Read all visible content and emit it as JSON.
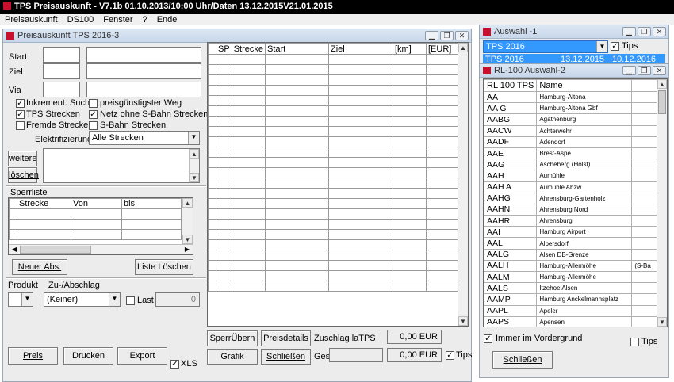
{
  "app": {
    "title": "TPS Preisauskunft  - V7.1b 01.10.2013/10:00 Uhr/Daten 13.12.2015V21.01.2015",
    "menu": [
      "Preisauskunft",
      "DS100",
      "Fenster",
      "?",
      "Ende"
    ]
  },
  "preis_window": {
    "title": "Preisauskunft TPS 2016-3",
    "labels": {
      "start": "Start",
      "ziel": "Ziel",
      "via": "Via"
    },
    "checks": {
      "inkrement": {
        "label": "Inkrement. Suche",
        "checked": true
      },
      "preisguenstig": {
        "label": "preisgünstigster Weg",
        "checked": false
      },
      "tps_strecken": {
        "label": "TPS Strecken",
        "checked": true
      },
      "netz_ohne_sbahn": {
        "label": "Netz ohne S-Bahn Strecken",
        "checked": true
      },
      "fremde": {
        "label": "Fremde Strecken",
        "checked": false
      },
      "sbahn": {
        "label": "S-Bahn Strecken",
        "checked": false
      }
    },
    "elektrifizierung": {
      "label": "Elektrifizierung",
      "value": "Alle Strecken"
    },
    "weitere_label": "weitere",
    "loeschen_label": "löschen",
    "sperrliste": {
      "title": "Sperrliste",
      "columns": [
        "Strecke",
        "Von",
        "bis"
      ]
    },
    "neuer_abs_label": "Neuer Abs.",
    "liste_loeschen_label": "Liste Löschen",
    "produkt_label": "Produkt",
    "zuabschlag_label": "Zu-/Abschlag",
    "zuabschlag_value": "(Keiner)",
    "last_label": "Last",
    "last_value": "0",
    "results_columns": [
      "SP",
      "Strecke",
      "Start",
      "Ziel",
      "[km]",
      "[EUR]"
    ],
    "buttons": {
      "sperr_uebern": "SperrÜbern",
      "preisdetails": "Preisdetails",
      "grafik": "Grafik",
      "schliessen": "Schließen",
      "preis": "Preis",
      "drucken": "Drucken",
      "export": "Export"
    },
    "zuschlag_label": "Zuschlag laTPS",
    "zuschlag_value": "0,00 EUR",
    "ges_label": "Ges.",
    "ges_value": "0,00 EUR",
    "tips_label": "Tips",
    "xls_label": "XLS"
  },
  "auswahl_window": {
    "title": "Auswahl -1",
    "combo_value": "TPS 2016",
    "tips_label": "Tips",
    "selected_row": [
      "TPS 2016",
      "13.12.2015",
      "10.12.2016"
    ]
  },
  "rl_window": {
    "title": "RL-100 Auswahl-2",
    "columns": [
      "RL 100 TPS",
      "Name"
    ],
    "rows": [
      [
        "AA",
        "Hamburg-Altona"
      ],
      [
        "AA  G",
        "Hamburg-Altona Gbf"
      ],
      [
        "AABG",
        "Agathenburg"
      ],
      [
        "AACW",
        "Achterwehr"
      ],
      [
        "AADF",
        "Adendorf"
      ],
      [
        "AAE",
        "Brest-Aspe"
      ],
      [
        "AAG",
        "Ascheberg (Holst)"
      ],
      [
        "AAH",
        "Aumühle"
      ],
      [
        "AAH A",
        "Aumühle Abzw"
      ],
      [
        "AAHG",
        "Ahrensburg-Gartenholz"
      ],
      [
        "AAHN",
        "Ahrensburg Nord"
      ],
      [
        "AAHR",
        "Ahrensburg"
      ],
      [
        "AAI",
        "Hamburg Airport"
      ],
      [
        "AAL",
        "Albersdorf"
      ],
      [
        "AALG",
        "Alsen DB-Grenze"
      ],
      [
        "AALH",
        "Hamburg-Allermöhe",
        "(S-Ba"
      ],
      [
        "AALM",
        "Hamburg-Allermöhe"
      ],
      [
        "AALS",
        "Itzehoe Alsen"
      ],
      [
        "AAMP",
        "Hamburg Anckelmannsplatz"
      ],
      [
        "AAPL",
        "Apeler"
      ],
      [
        "AAPS",
        "Apensen"
      ]
    ],
    "immer_label": "Immer im Vordergrund",
    "tips_label": "Tips",
    "schliessen_label": "Schließen"
  }
}
